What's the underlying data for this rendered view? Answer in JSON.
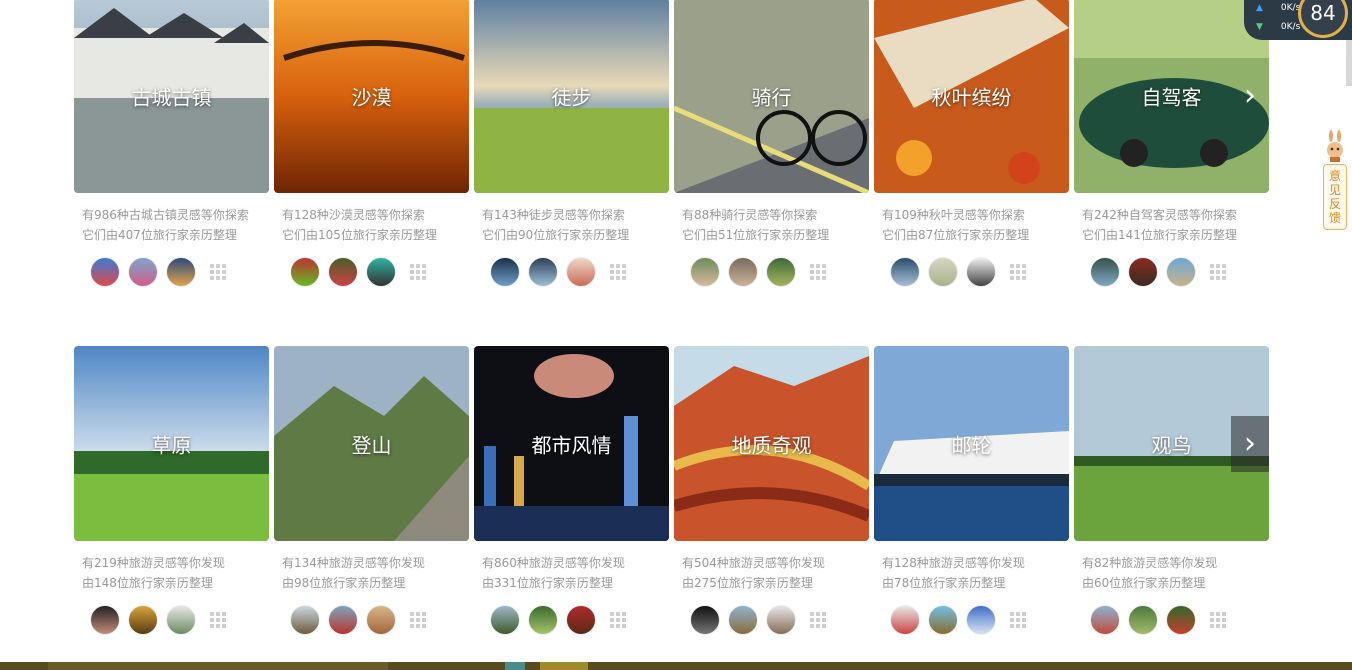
{
  "colors": {
    "meta_text": "#9a9a9a",
    "accent": "#e28a20"
  },
  "row1": [
    {
      "title": "古城古镇",
      "line1": "有986种古城古镇灵感等你探索",
      "line2": "它们由407位旅行家亲历整理"
    },
    {
      "title": "沙漠",
      "line1": "有128种沙漠灵感等你探索",
      "line2": "它们由105位旅行家亲历整理"
    },
    {
      "title": "徒步",
      "line1": "有143种徒步灵感等你探索",
      "line2": "它们由90位旅行家亲历整理"
    },
    {
      "title": "骑行",
      "line1": "有88种骑行灵感等你探索",
      "line2": "它们由51位旅行家亲历整理"
    },
    {
      "title": "秋叶缤纷",
      "line1": "有109种秋叶灵感等你探索",
      "line2": "它们由87位旅行家亲历整理"
    },
    {
      "title": "自驾客",
      "line1": "有242种自驾客灵感等你探索",
      "line2": "它们由141位旅行家亲历整理"
    }
  ],
  "row2": [
    {
      "title": "草原",
      "line1": "有219种旅游灵感等你发现",
      "line2": "由148位旅行家亲历整理"
    },
    {
      "title": "登山",
      "line1": "有134种旅游灵感等你发现",
      "line2": "由98位旅行家亲历整理"
    },
    {
      "title": "都市风情",
      "line1": "有860种旅游灵感等你发现",
      "line2": "由331位旅行家亲历整理"
    },
    {
      "title": "地质奇观",
      "line1": "有504种旅游灵感等你发现",
      "line2": "由275位旅行家亲历整理"
    },
    {
      "title": "邮轮",
      "line1": "有128种旅游灵感等你发现",
      "line2": "由78位旅行家亲历整理"
    },
    {
      "title": "观鸟",
      "line1": "有82种旅游灵感等你发现",
      "line2": "由60位旅行家亲历整理"
    }
  ],
  "feedback": {
    "label": "意见反馈"
  },
  "net": {
    "up": "0K/s",
    "down": "0K/s",
    "cpu": "84"
  },
  "icons": {
    "next": "chevron-right-icon",
    "more": "grid-icon",
    "feedback": "rabbit-icon"
  }
}
